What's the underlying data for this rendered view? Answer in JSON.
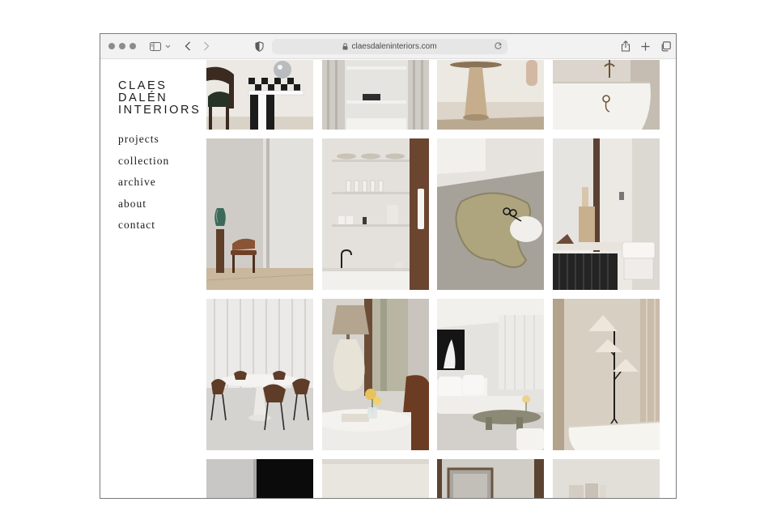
{
  "browser": {
    "url": "claesdaleninteriors.com",
    "icons": [
      "sidebar-icon",
      "chevron-down-icon",
      "back-icon",
      "forward-icon",
      "shield-icon",
      "lock-icon",
      "reload-icon",
      "share-icon",
      "new-tab-icon",
      "tabs-overview-icon"
    ]
  },
  "site": {
    "logo_lines": [
      "CLAES",
      "DALÉN",
      "INTERIORS"
    ],
    "nav": [
      {
        "label": "projects"
      },
      {
        "label": "collection"
      },
      {
        "label": "archive"
      },
      {
        "label": "about"
      },
      {
        "label": "contact"
      }
    ]
  },
  "gallery": {
    "tiles": [
      {
        "subject": "checkered stool with disco ball and wooden chair"
      },
      {
        "subject": "curtained shelving niche"
      },
      {
        "subject": "stone pedestal table"
      },
      {
        "subject": "bathtub with brass faucet"
      },
      {
        "subject": "wooden chair and green vase on pedestal"
      },
      {
        "subject": "kitchen shelves with glassware"
      },
      {
        "subject": "sculpted stone table with candle snuffer"
      },
      {
        "subject": "window with wooden sculpture and stool"
      },
      {
        "subject": "dining table with wooden chairs"
      },
      {
        "subject": "table lamp with yellow flowers"
      },
      {
        "subject": "living room with white sofa"
      },
      {
        "subject": "three-shade floor lamp"
      },
      {
        "subject": "black panel"
      },
      {
        "subject": "pale wall"
      },
      {
        "subject": "framed mirror"
      },
      {
        "subject": "ceramic objects"
      }
    ]
  },
  "colors": {
    "toolbar_bg": "#f2f2f2",
    "text": "#1a1a1a",
    "window_border": "#7a7a7a"
  }
}
